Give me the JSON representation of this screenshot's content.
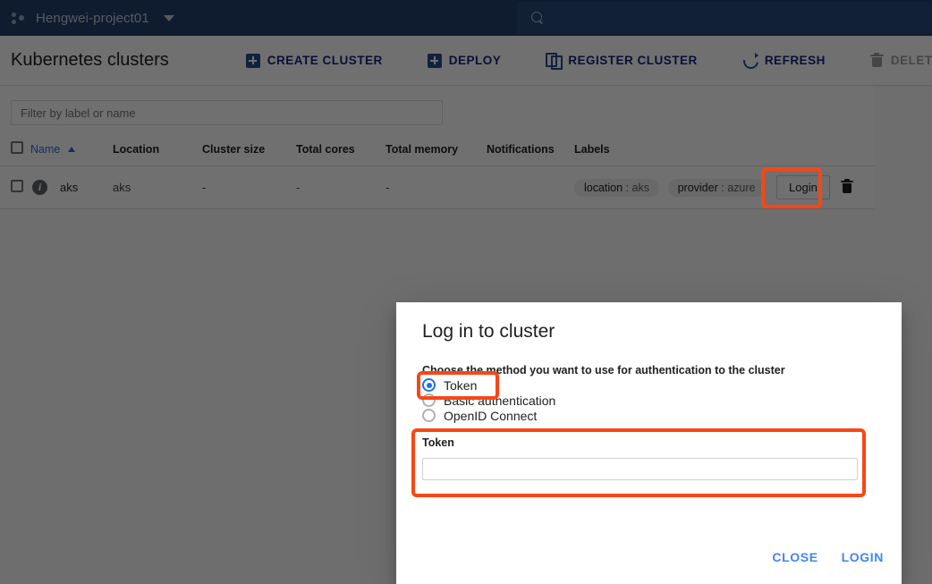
{
  "topbar": {
    "brand_icon": "google-cloud-dots-icon",
    "project_name": "Hengwei-project01",
    "caret_icon": "chevron-down-icon",
    "search_icon": "search-icon",
    "search_placeholder": ""
  },
  "page": {
    "title": "Kubernetes clusters"
  },
  "toolbar": {
    "buttons": [
      {
        "label": "CREATE CLUSTER",
        "icon": "plus-box-icon",
        "disabled": false
      },
      {
        "label": "DEPLOY",
        "icon": "plus-box-icon",
        "disabled": false
      },
      {
        "label": "REGISTER CLUSTER",
        "icon": "copy-icon",
        "disabled": false
      },
      {
        "label": "REFRESH",
        "icon": "refresh-icon",
        "disabled": false
      },
      {
        "label": "DELETE",
        "icon": "trash-icon",
        "disabled": true
      }
    ]
  },
  "filter": {
    "placeholder": "Filter by label or name",
    "value": ""
  },
  "table": {
    "columns": [
      "Name",
      "Location",
      "Cluster size",
      "Total cores",
      "Total memory",
      "Notifications",
      "Labels"
    ],
    "sorted_column": "Name",
    "sort_direction": "asc",
    "rows": [
      {
        "name": "aks",
        "location": "aks",
        "cluster_size": "-",
        "total_cores": "-",
        "total_memory": "-",
        "notifications": "",
        "labels": [
          {
            "key": "location",
            "value": "aks"
          },
          {
            "key": "provider",
            "value": "azure"
          }
        ],
        "action_label": "Login",
        "delete_icon": "trash-icon",
        "status_icon": "info-icon"
      }
    ]
  },
  "dialog": {
    "title": "Log in to cluster",
    "description": "Choose the method you want to use for authentication to the cluster",
    "options": [
      {
        "label": "Token",
        "selected": true
      },
      {
        "label": "Basic authentication",
        "selected": false
      },
      {
        "label": "OpenID Connect",
        "selected": false
      }
    ],
    "token_field": {
      "label": "Token",
      "value": "",
      "placeholder": ""
    },
    "close_label": "CLOSE",
    "login_label": "LOGIN"
  },
  "annotations": {
    "highlight_color": "#fa4616",
    "boxes": [
      "login-button-highlight",
      "token-radio-highlight",
      "token-field-highlight"
    ]
  },
  "colors": {
    "topbar_blue": "#23416e",
    "search_blue": "#2a4a7a",
    "link_blue": "#4285f4",
    "toolbar_blue": "#1a237e",
    "radio_blue": "#1a73e8",
    "highlight_orange": "#fa4616"
  }
}
